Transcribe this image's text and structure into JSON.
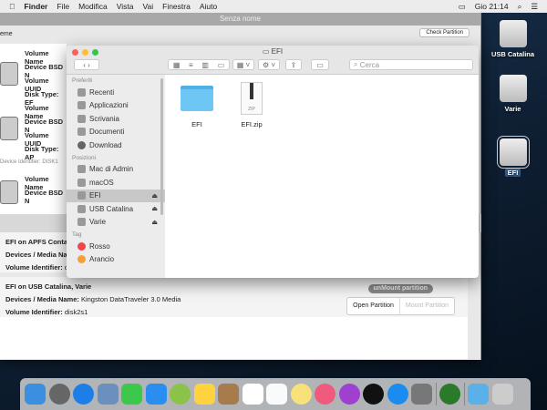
{
  "menubar": {
    "apple": "",
    "app": "Finder",
    "items": [
      "File",
      "Modifica",
      "Vista",
      "Vai",
      "Finestra",
      "Aiuto"
    ],
    "clock": "Gio 21:14"
  },
  "bgwindow": {
    "title": "Senza nome",
    "column_label": "eme",
    "check_button": "Check Partition",
    "disks": [
      {
        "rows": [
          "Volume Name",
          "Device BSD N",
          "Volume UUID",
          "Disk Type: EF"
        ]
      },
      {
        "rows": [
          "Volume Name",
          "Device BSD N",
          "Volume UUID",
          "Disk Type: AP"
        ]
      },
      {
        "rows": [
          "Volume Name",
          "Device BSD N"
        ]
      }
    ],
    "group_label": "Device Identifier: DISK1",
    "sections": [
      {
        "title": "EFI on APFS Conta",
        "media_label": "Devices / Media Nam",
        "id_label": "Volume Identifier:",
        "id_value": "d"
      },
      {
        "title": "EFI on USB Catalina, Varie",
        "media_label": "Devices / Media Name:",
        "media_value": "Kingston DataTraveler 3.0 Media",
        "id_label": "Volume Identifier:",
        "id_value": "disk2s1"
      }
    ],
    "unmount_button": "unMount partition",
    "open_button": "Open Partition",
    "mount_button": "Mount Partition"
  },
  "finder": {
    "title": "EFI",
    "search_placeholder": "Cerca",
    "sidebar": {
      "favorites_header": "Preferiti",
      "favorites": [
        "Recenti",
        "Applicazioni",
        "Scrivania",
        "Documenti",
        "Download"
      ],
      "locations_header": "Posizioni",
      "locations": [
        {
          "label": "Mac di Admin",
          "eject": ""
        },
        {
          "label": "macOS",
          "eject": ""
        },
        {
          "label": "EFI",
          "eject": "⏏",
          "selected": true
        },
        {
          "label": "USB Catalina",
          "eject": "⏏"
        },
        {
          "label": "Varie",
          "eject": "⏏"
        }
      ],
      "tags_header": "Tag",
      "tags": [
        {
          "label": "Rosso",
          "color": "#f0444f"
        },
        {
          "label": "Arancio",
          "color": "#f5a03a"
        }
      ]
    },
    "files": [
      {
        "name": "EFI",
        "type": "folder"
      },
      {
        "name": "EFI.zip",
        "type": "zip",
        "badge": "ZIP"
      }
    ]
  },
  "desktop": [
    {
      "label": "USB Catalina"
    },
    {
      "label": "Varie"
    },
    {
      "label": "EFI",
      "selected": true
    }
  ],
  "dock": {
    "colors": [
      "#3b8fe0",
      "#666",
      "#1e7ee8",
      "#6b8fbf",
      "#3cc84a",
      "#2a8ef0",
      "#8bc34a",
      "#ffd23f",
      "#a77b4b",
      "#fff",
      "#fafafa",
      "#f7e27a",
      "#f05a7e",
      "#a040d0",
      "#111",
      "#1a8cf0",
      "#777",
      "#2a7a2a",
      "#5ab0e8",
      "#ccc"
    ]
  }
}
